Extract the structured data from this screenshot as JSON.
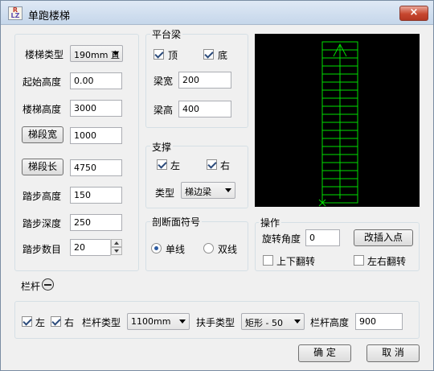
{
  "window": {
    "title": "单跑楼梯",
    "close_glyph": "×",
    "icon_top": "R",
    "icon_bottom": "LZ"
  },
  "left": {
    "stair_type_label": "楼梯类型",
    "stair_type_value": "190mm 直",
    "start_height_label": "起始高度",
    "start_height_value": "0.00",
    "stair_height_label": "楼梯高度",
    "stair_height_value": "3000",
    "seg_width_button": "梯段宽",
    "seg_width_value": "1000",
    "seg_length_button": "梯段长",
    "seg_length_value": "4750",
    "step_height_label": "踏步高度",
    "step_height_value": "150",
    "step_depth_label": "踏步深度",
    "step_depth_value": "250",
    "step_count_label": "踏步数目",
    "step_count_value": "20"
  },
  "platform_beam": {
    "legend": "平台梁",
    "top_label": "顶",
    "top_checked": true,
    "bottom_label": "底",
    "bottom_checked": true,
    "width_label": "梁宽",
    "width_value": "200",
    "height_label": "梁高",
    "height_value": "400"
  },
  "support": {
    "legend": "支撑",
    "left_label": "左",
    "left_checked": true,
    "right_label": "右",
    "right_checked": true,
    "type_label": "类型",
    "type_value": "梯边梁"
  },
  "section_symbol": {
    "legend": "剖断面符号",
    "single_label": "单线",
    "single_selected": true,
    "double_label": "双线",
    "double_selected": false
  },
  "operation": {
    "legend": "操作",
    "rotate_label": "旋转角度",
    "rotate_value": "0",
    "insert_button": "改插入点",
    "flip_ud_label": "上下翻转",
    "flip_ud_checked": false,
    "flip_lr_label": "左右翻转",
    "flip_lr_checked": false
  },
  "railing": {
    "label": "栏杆",
    "left_label": "左",
    "left_checked": true,
    "right_label": "右",
    "right_checked": true,
    "type_label": "栏杆类型",
    "type_value": "1100mm",
    "handrail_label": "扶手类型",
    "handrail_value": "矩形 - 50",
    "height_label": "栏杆高度",
    "height_value": "900"
  },
  "buttons": {
    "ok": "确 定",
    "cancel": "取 消"
  },
  "preview": {
    "bg_color": "#000000",
    "line_color": "#00e000",
    "step_lines": 20
  }
}
